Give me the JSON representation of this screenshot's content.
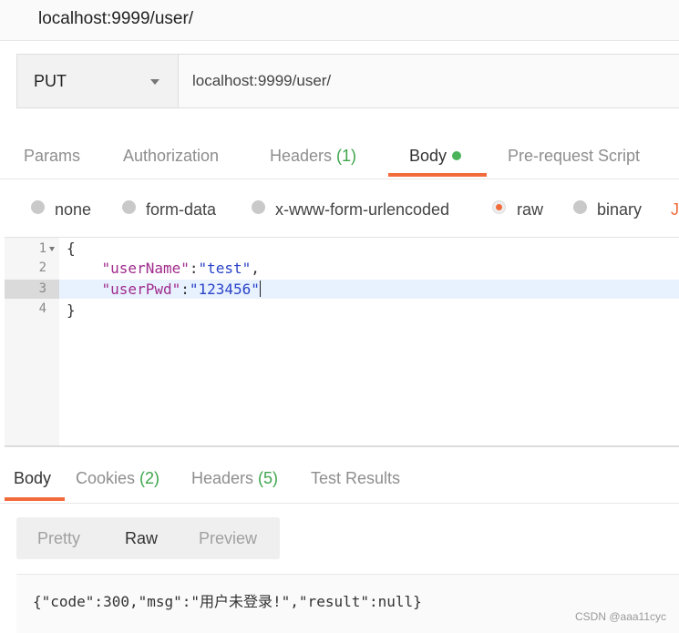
{
  "title": "localhost:9999/user/",
  "request": {
    "method": "PUT",
    "url": "localhost:9999/user/"
  },
  "request_tabs": [
    {
      "label": "Params"
    },
    {
      "label": "Authorization"
    },
    {
      "label": "Headers ",
      "count": "(1)"
    },
    {
      "label": "Body"
    },
    {
      "label": "Pre-request Script"
    }
  ],
  "body_types": [
    "none",
    "form-data",
    "x-www-form-urlencoded",
    "raw",
    "binary"
  ],
  "body_types_cut_letter": "J",
  "editor": {
    "line_numbers": [
      "1",
      "2",
      "3",
      "4"
    ],
    "line1": "{",
    "l2_indent": "    ",
    "l2_key": "\"userName\"",
    "l2_colon": ":",
    "l2_val": "\"test\"",
    "l2_comma": ",",
    "l3_indent": "    ",
    "l3_key": "\"userPwd\"",
    "l3_colon": ":",
    "l3_val": "\"123456\"",
    "line4": "}"
  },
  "response_tabs": [
    {
      "label": "Body"
    },
    {
      "label": "Cookies ",
      "count": "(2)"
    },
    {
      "label": "Headers ",
      "count": "(5)"
    },
    {
      "label": "Test Results"
    }
  ],
  "view_modes": [
    "Pretty",
    "Raw",
    "Preview"
  ],
  "response_body": "{\"code\":300,\"msg\":\"用户未登录!\",\"result\":null}",
  "watermark": "CSDN @aaa11cyc",
  "colors": {
    "accent": "#f26b3a",
    "count_green": "#3ea54c",
    "string_blue": "#2a43c8",
    "key_purple": "#a02b8c"
  }
}
